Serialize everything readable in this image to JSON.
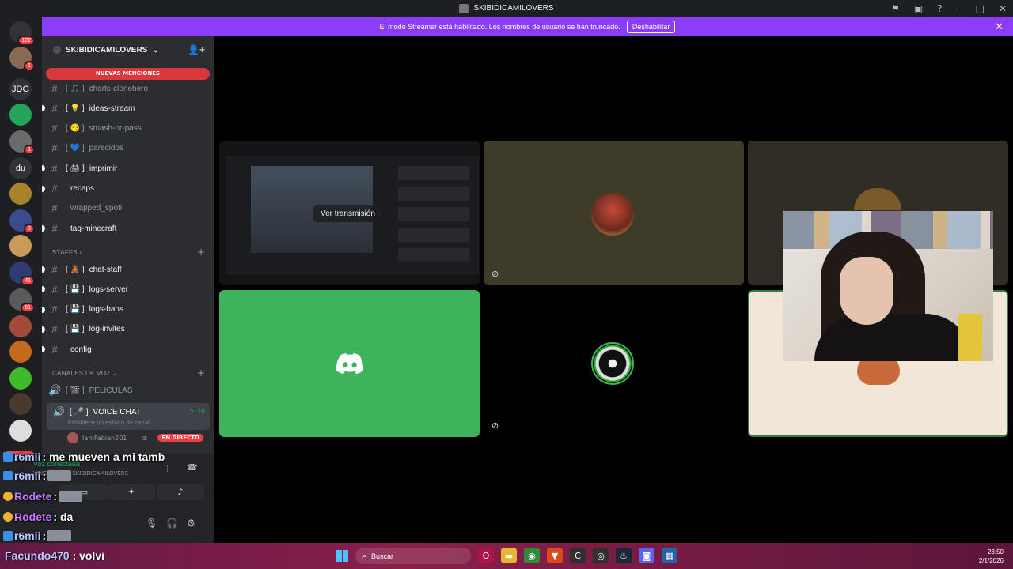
{
  "window": {
    "title": "SKIBIDICAMILOVERS"
  },
  "banner": {
    "text": "El modo Streamer está habilitado. Los nombres de usuario se han truncado.",
    "button": "Deshabilitar"
  },
  "rail": {
    "servers": [
      {
        "label": "",
        "badge": "122",
        "icon": "discord-home-icon",
        "color": "#313338"
      },
      {
        "label": "",
        "badge": "1",
        "icon": "server-avatar",
        "color": "#8a6a52"
      },
      {
        "label": "JDG",
        "badge": "",
        "icon": "",
        "color": "#313338"
      },
      {
        "label": "",
        "badge": "",
        "icon": "leaf-icon",
        "color": "#23a55a"
      },
      {
        "label": "",
        "badge": "1",
        "icon": "server-avatar",
        "color": "#6b6b6b"
      },
      {
        "label": "du",
        "badge": "",
        "icon": "",
        "color": "#313338"
      },
      {
        "label": "",
        "badge": "",
        "icon": "server-avatar",
        "color": "#a8822d"
      },
      {
        "label": "",
        "badge": "3",
        "icon": "server-avatar",
        "color": "#3b4b8c"
      },
      {
        "label": "",
        "badge": "",
        "icon": "server-avatar",
        "color": "#c99a5a"
      },
      {
        "label": "",
        "badge": "41",
        "icon": "server-avatar",
        "color": "#2e3c73"
      },
      {
        "label": "",
        "badge": "61",
        "icon": "server-avatar",
        "color": "#5a5a5a"
      },
      {
        "label": "",
        "badge": "",
        "icon": "server-avatar",
        "color": "#a34a3a"
      },
      {
        "label": "",
        "badge": "",
        "icon": "server-avatar",
        "color": "#c46a1c"
      },
      {
        "label": "",
        "badge": "",
        "icon": "server-avatar",
        "color": "#3dbb2a"
      },
      {
        "label": "",
        "badge": "",
        "icon": "server-avatar",
        "color": "#4a3a2e"
      },
      {
        "label": "",
        "badge": "",
        "icon": "server-avatar",
        "color": "#dddddd"
      }
    ],
    "new_label": "NUEVO"
  },
  "sidebar": {
    "server_name": "SKIBIDICAMILOVERS",
    "mentions_pill": "NUEVAS MENCIONES",
    "channels": [
      {
        "name": "charts-clonehero",
        "prefix": "[ 🎵 ]",
        "unread": false
      },
      {
        "name": "ideas-stream",
        "prefix": "[ 💡 ]",
        "unread": true
      },
      {
        "name": "smash-or-pass",
        "prefix": "[ 😏 ]",
        "unread": false
      },
      {
        "name": "parecidos",
        "prefix": "[ 💙 ]",
        "unread": false
      },
      {
        "name": "imprimir",
        "prefix": "[ 🖨 ]",
        "unread": true
      },
      {
        "name": "recaps",
        "prefix": "",
        "unread": true
      },
      {
        "name": "wrapped_spoti",
        "prefix": "",
        "unread": false
      },
      {
        "name": "tag-minecraft",
        "prefix": "",
        "unread": true
      }
    ],
    "staff_category": "STAFFS",
    "staff_channels": [
      {
        "name": "chat-staff",
        "prefix": "[ 🧸 ]"
      },
      {
        "name": "logs-server",
        "prefix": "[ 💾 ]"
      },
      {
        "name": "logs-bans",
        "prefix": "[ 💾 ]"
      },
      {
        "name": "log-invites",
        "prefix": "[ 💾 ]"
      },
      {
        "name": "config",
        "prefix": ""
      }
    ],
    "voice_category": "CANALES DE VOZ",
    "voice_channels": [
      {
        "name": "PELICULAS",
        "prefix": "[ 🎬 ]"
      }
    ],
    "active_voice": {
      "name": "VOICE CHAT",
      "prefix": "[ 🎤 ]",
      "time": "5:28",
      "status": "Establece un estado de canal"
    },
    "voice_user": {
      "name": "IamFabian201",
      "live": "EN DIRECTO"
    }
  },
  "panel": {
    "voice_connected": "Voz conectada",
    "voice_sub": "VOICE CHAT / SKIBIDICAMILOVERS"
  },
  "overlay": {
    "lines": [
      {
        "user": "r6mii",
        "msg": ": me mueven a mi tamb"
      },
      {
        "user": "r6mii",
        "msg": ":"
      },
      {
        "user": "Rodete",
        "msg": ":"
      },
      {
        "user": "Rodete",
        "msg": ": da"
      },
      {
        "user": "r6mii",
        "msg": ":"
      }
    ]
  },
  "stage": {
    "watch_label": "Ver transmisión"
  },
  "taskbar": {
    "chat_user": "Facundo470",
    "chat_msg": ": volvi",
    "search_placeholder": "Buscar",
    "time": "23:50",
    "date": "2/1/2026"
  }
}
